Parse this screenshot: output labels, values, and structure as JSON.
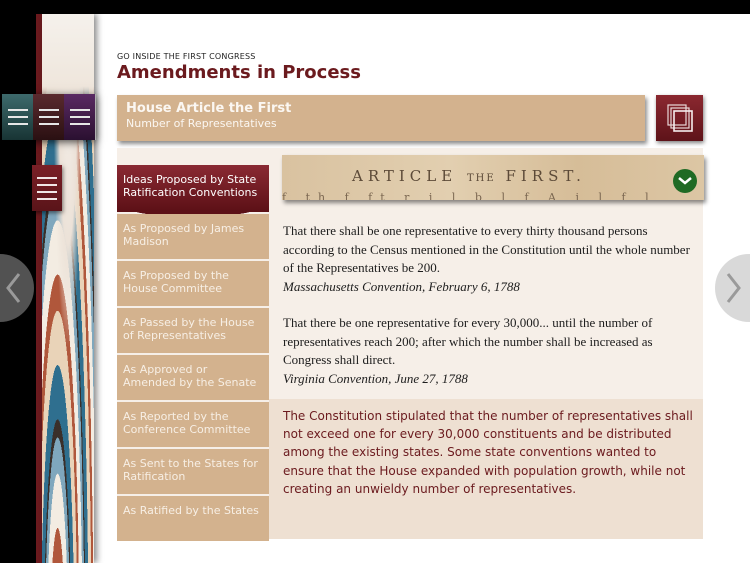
{
  "header": {
    "kicker": "GO INSIDE THE FIRST CONGRESS",
    "title": "Amendments in Process"
  },
  "article": {
    "title": "House Article the First",
    "subtitle": "Number of Representatives"
  },
  "icons": {
    "menu_trio": "menu-icon",
    "menu_red": "menu-icon",
    "compare": "stacked-pages-icon",
    "expand": "chevron-down-icon",
    "prev": "chevron-left-icon",
    "next": "chevron-right-icon"
  },
  "colors": {
    "brand": "#6b1a1e",
    "tan": "#d3b28e",
    "green": "#1f6a24"
  },
  "tabs": [
    {
      "label": "Ideas Proposed by State Ratification Conventions",
      "active": true
    },
    {
      "label": "As Proposed by James Madison",
      "active": false
    },
    {
      "label": "As Proposed by the House Committee",
      "active": false
    },
    {
      "label": "As Passed by the House of Representatives",
      "active": false
    },
    {
      "label": "As Approved or Amended by the Senate",
      "active": false
    },
    {
      "label": "As Reported by the Conference Committee",
      "active": false
    },
    {
      "label": "As Sent to the States for Ratification",
      "active": false
    },
    {
      "label": "As Ratified by the States",
      "active": false
    }
  ],
  "document": {
    "heading_a": "ARTICLE",
    "heading_b": "THE",
    "heading_c": "FIRST.",
    "faint_line": "f th  f ft    r     i   l  b  l  f  A  i l   f l"
  },
  "quotes": [
    {
      "text": "That there shall be one representative to every thirty thousand persons according to the Census mentioned in the Constitution until the whole number of the Representatives be 200.",
      "source": "Massachusetts Convention, February 6, 1788"
    },
    {
      "text": "That there be one representative for every 30,000... until the number of representatives reach 200; after which the number shall be increased as Congress shall direct.",
      "source": "Virginia Convention, June 27, 1788"
    }
  ],
  "note": "The Constitution stipulated that the number of representatives shall not exceed one for every 30,000 constituents and be distributed among the existing states. Some state conventions wanted to ensure that the House expanded with population growth, while not creating an unwieldy number of representatives."
}
